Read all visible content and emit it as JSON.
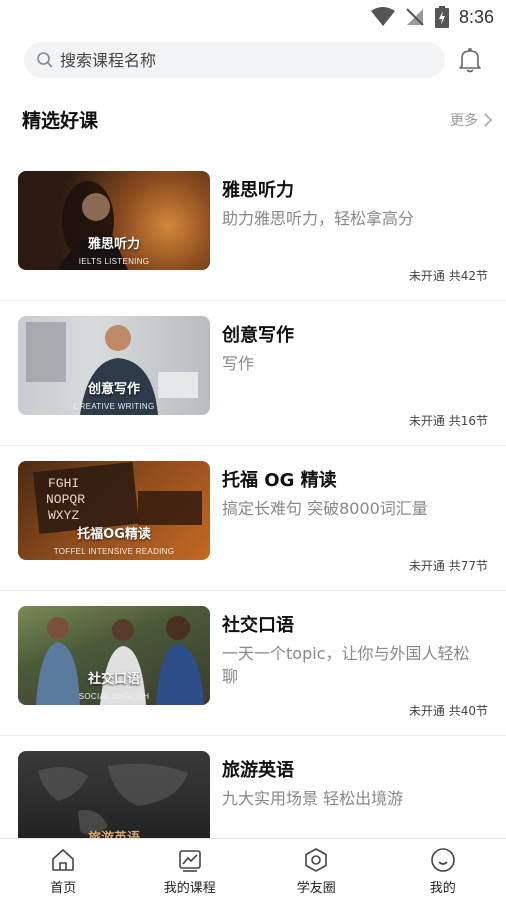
{
  "status_bar": {
    "time": "8:36"
  },
  "search": {
    "placeholder": "搜索课程名称"
  },
  "section": {
    "title": "精选好课",
    "more_label": "更多"
  },
  "courses": [
    {
      "title": "雅思听力",
      "desc": "助力雅思听力，轻松拿高分",
      "thumb_cn": "雅思听力",
      "thumb_en": "IELTS LISTENING",
      "status": "未开通",
      "lessons": "共42节"
    },
    {
      "title": "创意写作",
      "desc": "写作",
      "thumb_cn": "创意写作",
      "thumb_en": "CREATIVE WRITING",
      "status": "未开通",
      "lessons": "共16节"
    },
    {
      "title": "托福 OG 精读",
      "desc": "搞定长难句 突破8000词汇量",
      "thumb_cn": "托福OG精读",
      "thumb_en": "TOFFEL INTENSIVE READING",
      "status": "未开通",
      "lessons": "共77节"
    },
    {
      "title": "社交口语",
      "desc": "一天一个topic，让你与外国人轻松聊",
      "thumb_cn": "社交口语",
      "thumb_en": "SOCIAL ENGLISH",
      "status": "未开通",
      "lessons": "共40节"
    },
    {
      "title": "旅游英语",
      "desc": "九大实用场景 轻松出境游",
      "thumb_cn": "旅游英语",
      "thumb_en": "",
      "status": "",
      "lessons": ""
    }
  ],
  "nav": [
    {
      "label": "首页",
      "icon": "home-icon"
    },
    {
      "label": "我的课程",
      "icon": "chart-icon"
    },
    {
      "label": "学友圈",
      "icon": "hexagon-icon"
    },
    {
      "label": "我的",
      "icon": "smile-icon"
    }
  ]
}
